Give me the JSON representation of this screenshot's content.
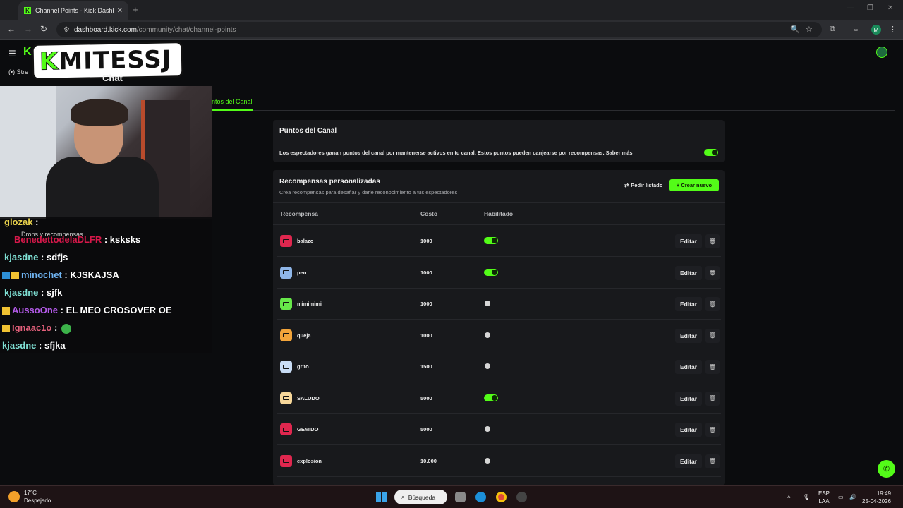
{
  "browser": {
    "tab_title": "Channel Points - Kick Dashboar",
    "tab_favicon": "K",
    "url_host": "dashboard.kick.com",
    "url_path": "/community/chat/channel-points",
    "profile_initial": "M"
  },
  "page": {
    "logo_text_k": "K",
    "logo_text_rest": "MITESSJ",
    "stream_label": "Stre",
    "chat_label": "Chat",
    "active_tab": "ntos del Canal"
  },
  "chat": {
    "messages": [
      {
        "user": "glozak",
        "text": " :",
        "color": "#e7d04c"
      },
      {
        "user": "BenedettodelaDLFR",
        "text": " : ksksks",
        "color": "#d6184a"
      },
      {
        "user": "kjasdne",
        "text": " : sdfjs",
        "color": "#7fe0d4"
      },
      {
        "user": "minochet",
        "text": " : KJSKAJSA",
        "color": "#6fb4f2"
      },
      {
        "user": "kjasdne",
        "text": " : sjfk",
        "color": "#7fe0d4"
      },
      {
        "user": "AussoOne",
        "text": " : EL MEO CROSOVER OE",
        "color": "#b35ae8"
      },
      {
        "user": "Ignaac1o",
        "text": " :",
        "color": "#e4607b"
      },
      {
        "user": "kjasdne",
        "text": " : sfjka",
        "color": "#7fe0d4"
      }
    ],
    "drops_overlay": "Drops y recompensas"
  },
  "channel_points": {
    "title": "Puntos del Canal",
    "description": "Los espectadores ganan puntos del canal por mantenerse activos en tu canal. Estos puntos pueden canjearse por recompensas. Saber más",
    "enabled": true
  },
  "rewards": {
    "title": "Recompensas personalizadas",
    "subtitle": "Crea recompensas para desafiar y darle reconocimiento a tus espectadores",
    "pedir_label": "Pedir listado",
    "crear_label": "+ Crear nuevo",
    "col_reward": "Recompensa",
    "col_cost": "Costo",
    "col_enabled": "Habilitado",
    "edit_label": "Editar",
    "items": [
      {
        "name": "balazo",
        "cost": "1000",
        "enabled": true,
        "color": "#e0274f"
      },
      {
        "name": "peo",
        "cost": "1000",
        "enabled": true,
        "color": "#8fb6e8"
      },
      {
        "name": "mimimimi",
        "cost": "1000",
        "enabled": false,
        "color": "#67e84a"
      },
      {
        "name": "queja",
        "cost": "1000",
        "enabled": false,
        "color": "#f2a43a"
      },
      {
        "name": "grito",
        "cost": "1500",
        "enabled": false,
        "color": "#c8dcf5"
      },
      {
        "name": "SALUDO",
        "cost": "5000",
        "enabled": true,
        "color": "#f7d79a"
      },
      {
        "name": "GEMIDO",
        "cost": "5000",
        "enabled": false,
        "color": "#e0274f"
      },
      {
        "name": "explosion",
        "cost": "10.000",
        "enabled": false,
        "color": "#e0274f"
      }
    ]
  },
  "taskbar": {
    "temp": "17°C",
    "weather": "Despejado",
    "search_label": "Búsqueda",
    "lang": "ESP",
    "lang2": "LAA",
    "time": "19:49",
    "date": "25-04-2026"
  }
}
